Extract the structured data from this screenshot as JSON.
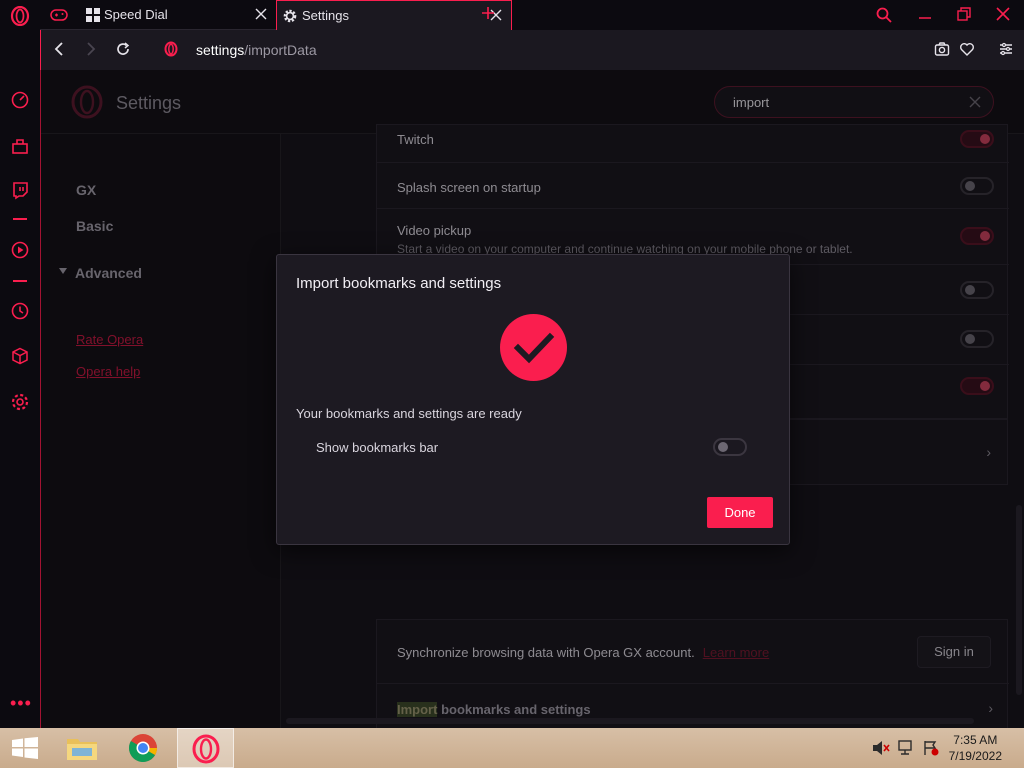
{
  "tabs": [
    {
      "label": "Speed Dial"
    },
    {
      "label": "Settings"
    }
  ],
  "address": {
    "host": "settings",
    "path": "/importData"
  },
  "page": {
    "title": "Settings",
    "search_value": "import"
  },
  "nav": {
    "items": [
      {
        "label": "GX"
      },
      {
        "label": "Basic"
      },
      {
        "label": "Advanced"
      }
    ],
    "links": [
      {
        "label": "Rate Opera"
      },
      {
        "label": "Opera help"
      }
    ]
  },
  "settings_rows": {
    "twitch": {
      "label": "Twitch",
      "state": "on"
    },
    "splash": {
      "label": "Splash screen on startup",
      "state": "off"
    },
    "video_pickup": {
      "label": "Video pickup",
      "sub": "Start a video on your computer and continue watching on your mobile phone or tablet.",
      "state": "on"
    },
    "sync": {
      "text": "Synchronize browsing data with Opera GX account.",
      "learn_more": "Learn more",
      "button": "Sign in"
    },
    "import": {
      "highlight": "Import",
      "rest": " bookmarks and settings"
    }
  },
  "dialog": {
    "title": "Import bookmarks and settings",
    "message": "Your bookmarks and settings are ready",
    "option_label": "Show bookmarks bar",
    "option_state": "off",
    "done_label": "Done"
  },
  "taskbar": {
    "time": "7:35 AM",
    "date": "7/19/2022"
  },
  "colors": {
    "accent": "#fa1e4e",
    "background": "#18151d",
    "dialog": "#1d1a22"
  }
}
